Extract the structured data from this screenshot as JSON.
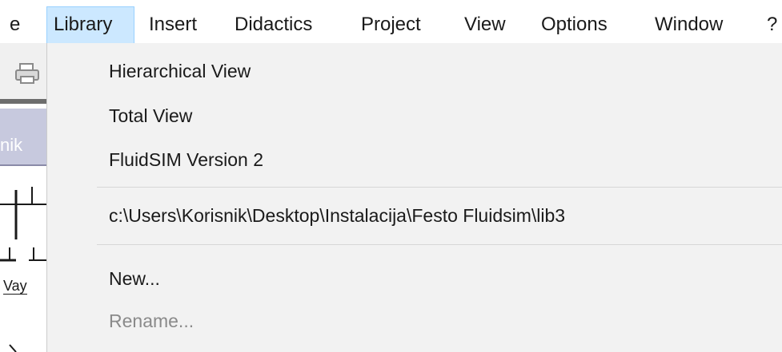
{
  "menubar": {
    "items": [
      {
        "label": "e"
      },
      {
        "label": "Library"
      },
      {
        "label": "Insert"
      },
      {
        "label": "Didactics"
      },
      {
        "label": "Project"
      },
      {
        "label": "View"
      },
      {
        "label": "Options"
      },
      {
        "label": "Window"
      },
      {
        "label": "?"
      }
    ],
    "active_highlight_color": "#cce8ff"
  },
  "background": {
    "tab_fragment": "nik",
    "symbol_fragment": "Vay",
    "print_icon": "printer-icon"
  },
  "library_menu": {
    "items": [
      {
        "label": "Hierarchical View",
        "enabled": true
      },
      {
        "label": "Total View",
        "enabled": true
      },
      {
        "label": "FluidSIM Version 2",
        "enabled": true
      },
      {
        "label": "c:\\Users\\Korisnik\\Desktop\\Instalacija\\Festo Fluidsim\\lib3",
        "enabled": true
      },
      {
        "label": "New...",
        "enabled": true
      },
      {
        "label": "Rename...",
        "enabled": false
      }
    ]
  }
}
